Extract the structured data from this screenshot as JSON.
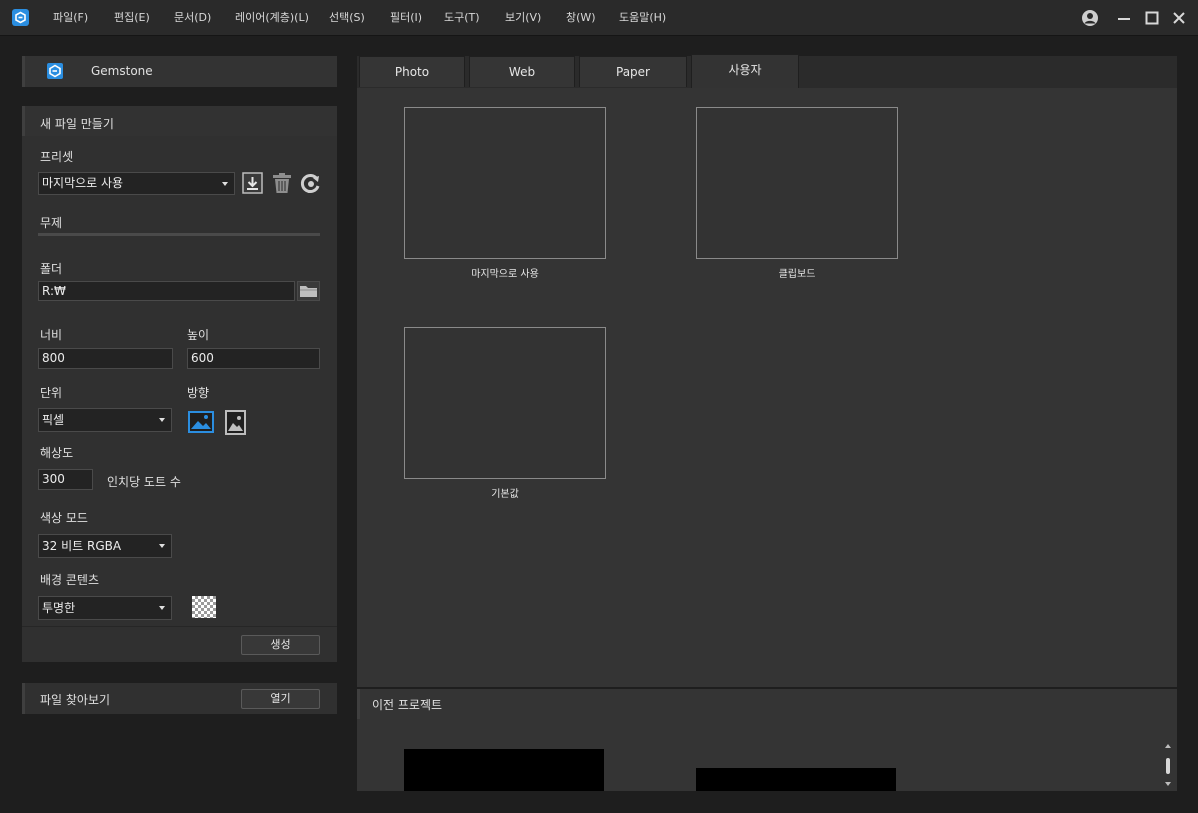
{
  "menu": {
    "items": [
      "파일(F)",
      "편집(E)",
      "문서(D)",
      "레이어(계층)(L)",
      "선택(S)",
      "필터(I)",
      "도구(T)",
      "보기(V)",
      "창(W)",
      "도움말(H)"
    ]
  },
  "sidebar": {
    "app_name": "Gemstone",
    "new_file": {
      "header": "새 파일 만들기",
      "preset_label": "프리셋",
      "preset_value": "마지막으로 사용",
      "title_value": "무제",
      "folder_label": "폴더",
      "folder_value": "R:₩",
      "width_label": "너비",
      "width_value": "800",
      "height_label": "높이",
      "height_value": "600",
      "unit_label": "단위",
      "unit_value": "픽셀",
      "orientation_label": "방향",
      "resolution_label": "해상도",
      "resolution_value": "300",
      "resolution_unit": "인치당 도트 수",
      "color_mode_label": "색상 모드",
      "color_mode_value": "32 비트 RGBA",
      "background_label": "배경 콘텐츠",
      "background_value": "투명한",
      "create_button": "생성"
    },
    "browse": {
      "label": "파일 찾아보기",
      "open_button": "열기"
    }
  },
  "tabs": [
    "Photo",
    "Web",
    "Paper",
    "사용자"
  ],
  "active_tab": "사용자",
  "presets": [
    {
      "label": "마지막으로 사용"
    },
    {
      "label": "클립보드"
    },
    {
      "label": "기본값"
    }
  ],
  "recent": {
    "header": "이전 프로젝트"
  },
  "colors": {
    "accent": "#2b8ee0",
    "background": "#1e1e1e",
    "panel": "#303030",
    "content": "#343434"
  }
}
